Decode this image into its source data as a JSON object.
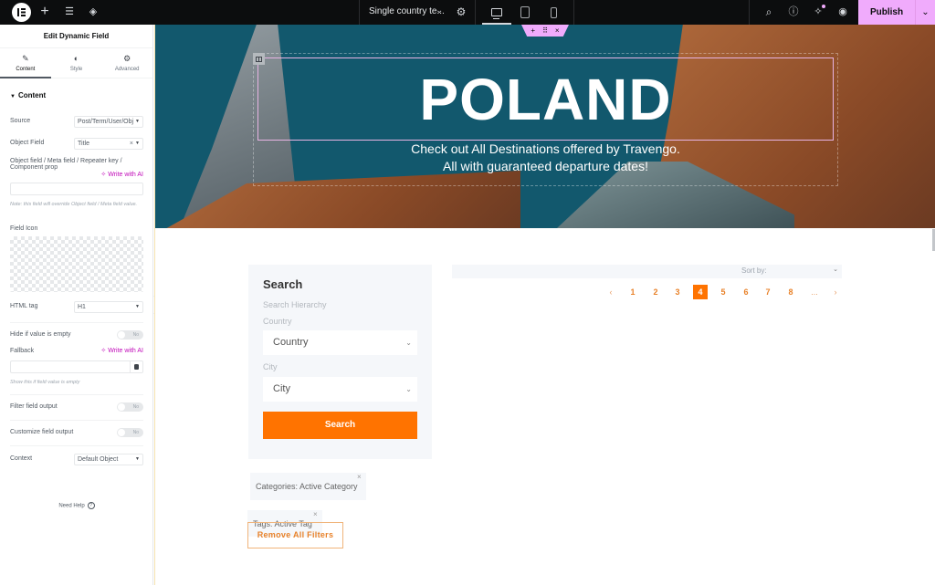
{
  "topbar": {
    "icons": [
      "elementor-logo-icon",
      "add-element-icon",
      "site-settings-icon",
      "structure-layers-icon"
    ],
    "document_title": "Single country te...",
    "devices": [
      "desktop",
      "tablet",
      "mobile"
    ],
    "active_device": "desktop",
    "right_icons": [
      "search-icon",
      "help-icon",
      "whats-new-icon",
      "preview-eye-icon"
    ],
    "publish_label": "Publish",
    "accent": "#f0abfc"
  },
  "panel": {
    "title": "Edit Dynamic Field",
    "tabs": [
      {
        "label": "Content",
        "icon": "✎",
        "active": true
      },
      {
        "label": "Style",
        "icon": "◐",
        "active": false
      },
      {
        "label": "Advanced",
        "icon": "⚙",
        "active": false
      }
    ],
    "section_label": "Content",
    "source": {
      "label": "Source",
      "value": "Post/Term/User/Obj"
    },
    "object_field": {
      "label": "Object Field",
      "value": "Title"
    },
    "meta_field": {
      "label": "Object field / Meta field / Repeater key / Component prop",
      "value": "",
      "note": "Note: this field will override Object field / Meta field value."
    },
    "write_with_ai": "Write with AI",
    "field_icon": {
      "label": "Field Icon"
    },
    "html_tag": {
      "label": "HTML tag",
      "value": "H1"
    },
    "hide_if_empty": {
      "label": "Hide if value is empty",
      "state": "No"
    },
    "fallback": {
      "label": "Fallback",
      "value": "",
      "note": "Show this if field value is empty"
    },
    "filter_output": {
      "label": "Filter field output",
      "state": "No"
    },
    "customize_output": {
      "label": "Customize field output",
      "state": "No"
    },
    "context": {
      "label": "Context",
      "value": "Default Object"
    },
    "need_help": "Need Help"
  },
  "hero": {
    "title": "POLAND",
    "subtitle_line1": "Check out All Destinations offered by Travengo.",
    "subtitle_line2": "All with guaranteed departure dates!"
  },
  "search_widget": {
    "title": "Search",
    "hierarchy_label": "Search Hierarchy",
    "country_label": "Country",
    "country_value": "Country",
    "city_label": "City",
    "city_value": "City",
    "button_label": "Search",
    "button_color": "#ff7300"
  },
  "results": {
    "sort_label": "Sort by:",
    "pagination": {
      "prev": "‹",
      "pages": [
        "1",
        "2",
        "3",
        "4",
        "5",
        "6",
        "7",
        "8"
      ],
      "current": "4",
      "ellipsis": "...",
      "next": "›"
    }
  },
  "filters": {
    "chips": [
      {
        "label": "Categories: Active Category"
      },
      {
        "label": "Tags: Active Tag"
      }
    ],
    "remove_all_label": "Remove All Filters"
  }
}
